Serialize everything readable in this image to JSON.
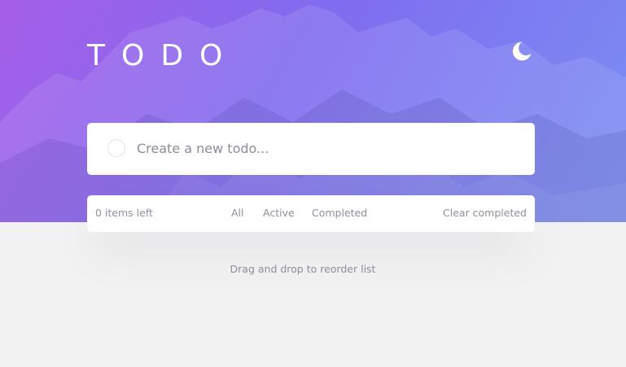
{
  "header": {
    "title": "TODO",
    "theme_toggle_icon": "moon-icon",
    "background_image": "mountain-peaks-photo",
    "gradient_colors": [
      "#a65ee8",
      "#7f6cf0",
      "#7a8ff2"
    ]
  },
  "new_todo": {
    "placeholder": "Create a new todo...",
    "value": "",
    "checkbox_icon": "empty-circle-icon"
  },
  "footer": {
    "items_left": "0 items left",
    "filters": [
      {
        "label": "All",
        "active": false
      },
      {
        "label": "Active",
        "active": false
      },
      {
        "label": "Completed",
        "active": false
      }
    ],
    "clear_label": "Clear completed"
  },
  "hint": "Drag and drop to reorder list",
  "colors": {
    "page_background": "#f2f2f2",
    "card_background": "#ffffff",
    "muted_text": "#8e8e9e"
  }
}
